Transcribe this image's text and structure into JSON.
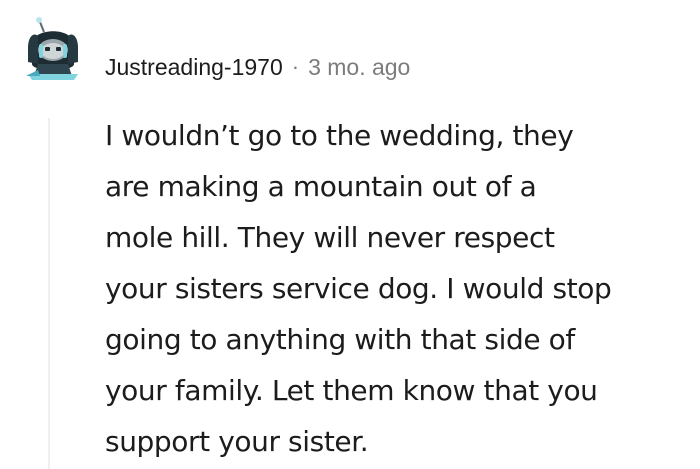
{
  "comment": {
    "author": "Justreading-1970",
    "separator": "·",
    "timestamp": "3 mo. ago",
    "avatar_icon": "snoo-avatar-icon",
    "body_lines": [
      "I wouldn’t go to the wedding, they",
      "are making a mountain out of a",
      "mole hill. They will never respect",
      "your sisters service dog. I would stop",
      "going to anything with that side of",
      "your family. Let them know that you",
      "support your sister."
    ]
  },
  "colors": {
    "text": "#1c1c1c",
    "meta": "#7c7c7c",
    "thread_line": "#edeff1",
    "avatar_dark": "#1d2b33",
    "avatar_accent": "#7fd4e0"
  }
}
